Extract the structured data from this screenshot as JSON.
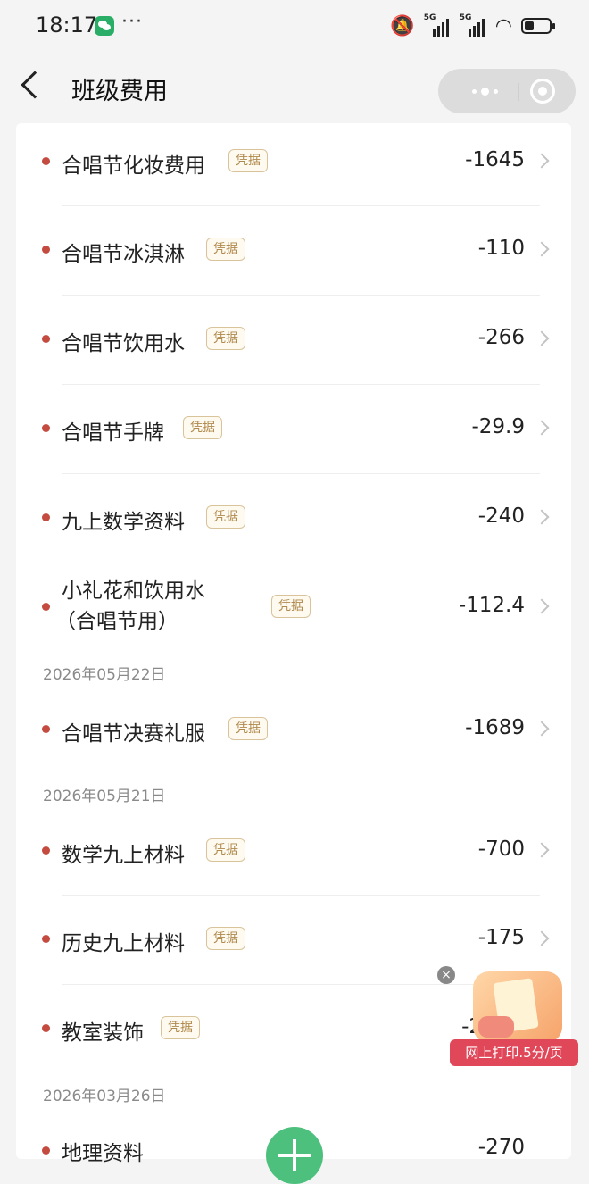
{
  "status_bar": {
    "time": "18:17",
    "net1": "5G",
    "net2": "5G"
  },
  "nav": {
    "title": "班级费用"
  },
  "receipt_tag": "凭据",
  "items": [
    {
      "name": "合唱节化妆费用",
      "amount": "-1645"
    },
    {
      "name": "合唱节冰淇淋",
      "amount": "-110"
    },
    {
      "name": "合唱节饮用水",
      "amount": "-266"
    },
    {
      "name": "合唱节手牌",
      "amount": "-29.9"
    },
    {
      "name": "九上数学资料",
      "amount": "-240"
    },
    {
      "name_line1": "小礼花和饮用水",
      "name_line2": "（合唱节用）",
      "amount": "-112.4"
    }
  ],
  "groups": [
    {
      "date": "2026年05月22日",
      "items": [
        {
          "name": "合唱节决赛礼服",
          "amount": "-1689"
        }
      ]
    },
    {
      "date": "2026年05月21日",
      "items": [
        {
          "name": "数学九上材料",
          "amount": "-700"
        },
        {
          "name": "历史九上材料",
          "amount": "-175"
        },
        {
          "name": "教室装饰",
          "amount": "-2"
        }
      ]
    },
    {
      "date": "2026年03月26日",
      "items": [
        {
          "name": "地理资料",
          "amount": "-270"
        }
      ]
    }
  ],
  "ad": {
    "label": "网上打印.5分/页",
    "close": "×"
  },
  "colors": {
    "dot": "#c44b3f",
    "tag_text": "#b08a4d",
    "fab": "#4cc07c",
    "ad": "#e0485a"
  }
}
